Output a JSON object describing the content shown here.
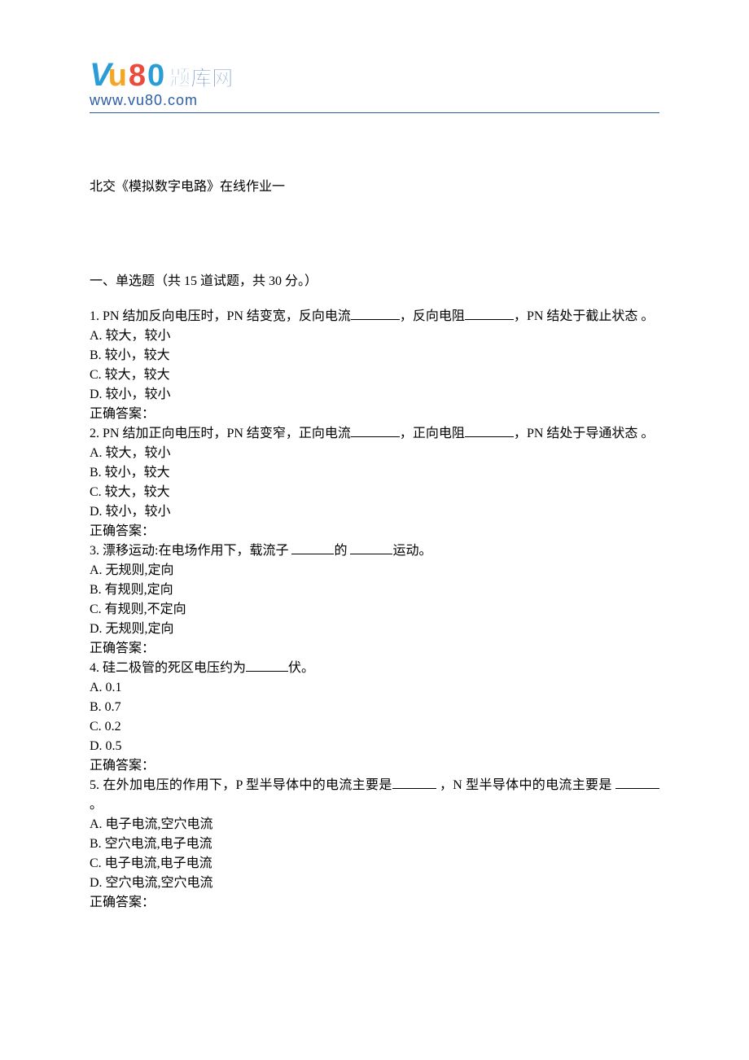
{
  "logo": {
    "v": "V",
    "u": "u",
    "eight": "8",
    "zero": "0",
    "cn": "题库网",
    "url": "www.vu80.com"
  },
  "title": "北交《模拟数字电路》在线作业一",
  "section": "一、单选题（共 15 道试题，共 30 分。）",
  "q1": {
    "stem_a": "1.   PN 结加反向电压时，PN 结变宽，反向电流",
    "stem_b": "，反向电阻",
    "stem_c": "，PN 结处于截止状态 。",
    "A": "A. 较大，较小",
    "B": "B. 较小，较大",
    "C": "C. 较大，较大",
    "D": "D. 较小，较小",
    "ans": "正确答案："
  },
  "q2": {
    "stem_a": "2.   PN 结加正向电压时，PN 结变窄，正向电流",
    "stem_b": "，正向电阻",
    "stem_c": "，PN 结处于导通状态 。",
    "A": "A. 较大，较小",
    "B": "B. 较小，较大",
    "C": "C. 较大，较大",
    "D": "D. 较小，较小",
    "ans": "正确答案："
  },
  "q3": {
    "stem_a": "3.   漂移运动:在电场作用下，载流子 ",
    "stem_b": "的 ",
    "stem_c": "运动。",
    "A": "A. 无规则,定向",
    "B": "B. 有规则,定向",
    "C": "C. 有规则,不定向",
    "D": "D. 无规则,定向",
    "ans": "正确答案："
  },
  "q4": {
    "stem_a": "4.   硅二极管的死区电压约为",
    "stem_b": "伏。",
    "A": "A. 0.1",
    "B": "B. 0.7",
    "C": "C. 0.2",
    "D": "D. 0.5",
    "ans": "正确答案："
  },
  "q5": {
    "stem_a": "5.   在外加电压的作用下，P 型半导体中的电流主要是",
    "stem_b": " ，N 型半导体中的电流主要是 ",
    "stem_c": "。",
    "A": "A. 电子电流,空穴电流",
    "B": "B. 空穴电流,电子电流",
    "C": "C. 电子电流,电子电流",
    "D": "D. 空穴电流,空穴电流",
    "ans": "正确答案："
  }
}
